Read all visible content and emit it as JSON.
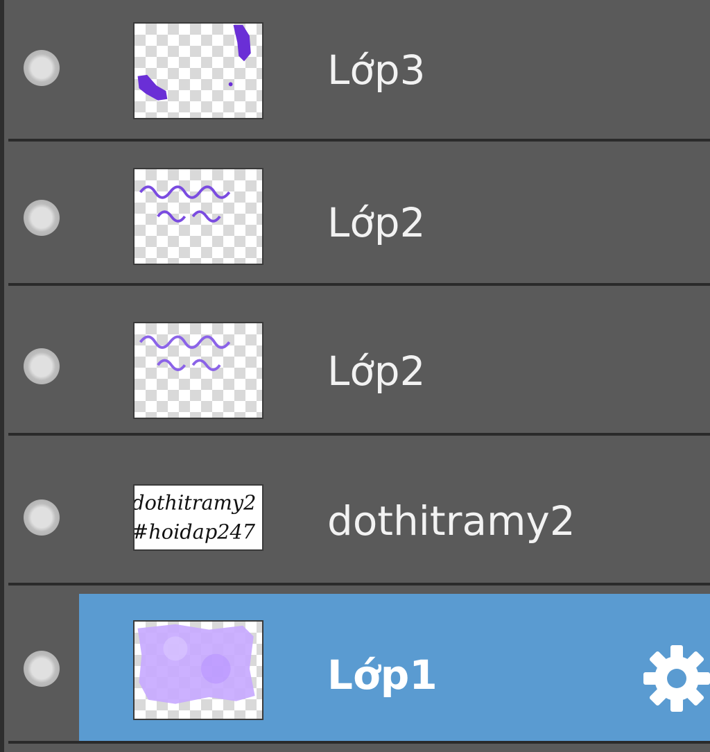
{
  "layers": [
    {
      "name": "Lớp3",
      "thumb": "purple-blotches",
      "selected": false
    },
    {
      "name": "Lớp2",
      "thumb": "purple-script",
      "selected": false
    },
    {
      "name": "Lớp2",
      "thumb": "purple-script",
      "selected": false
    },
    {
      "name": "dothitramy2",
      "thumb": "black-text",
      "thumb_text": [
        "dothitramy2",
        "#hoidap247"
      ],
      "selected": false
    },
    {
      "name": "Lớp1",
      "thumb": "lavender-fill",
      "selected": true
    }
  ],
  "colors": {
    "panel_bg": "#5a5a5a",
    "divider": "#2a2a2a",
    "selected_bg": "#5a9bd1",
    "label_text": "#f2f2f2",
    "accent_purple": "#6a2fd6",
    "lavender": "#c7a9ff"
  },
  "icons": {
    "visibility": "visibility-dot-icon",
    "settings": "gear-icon"
  }
}
